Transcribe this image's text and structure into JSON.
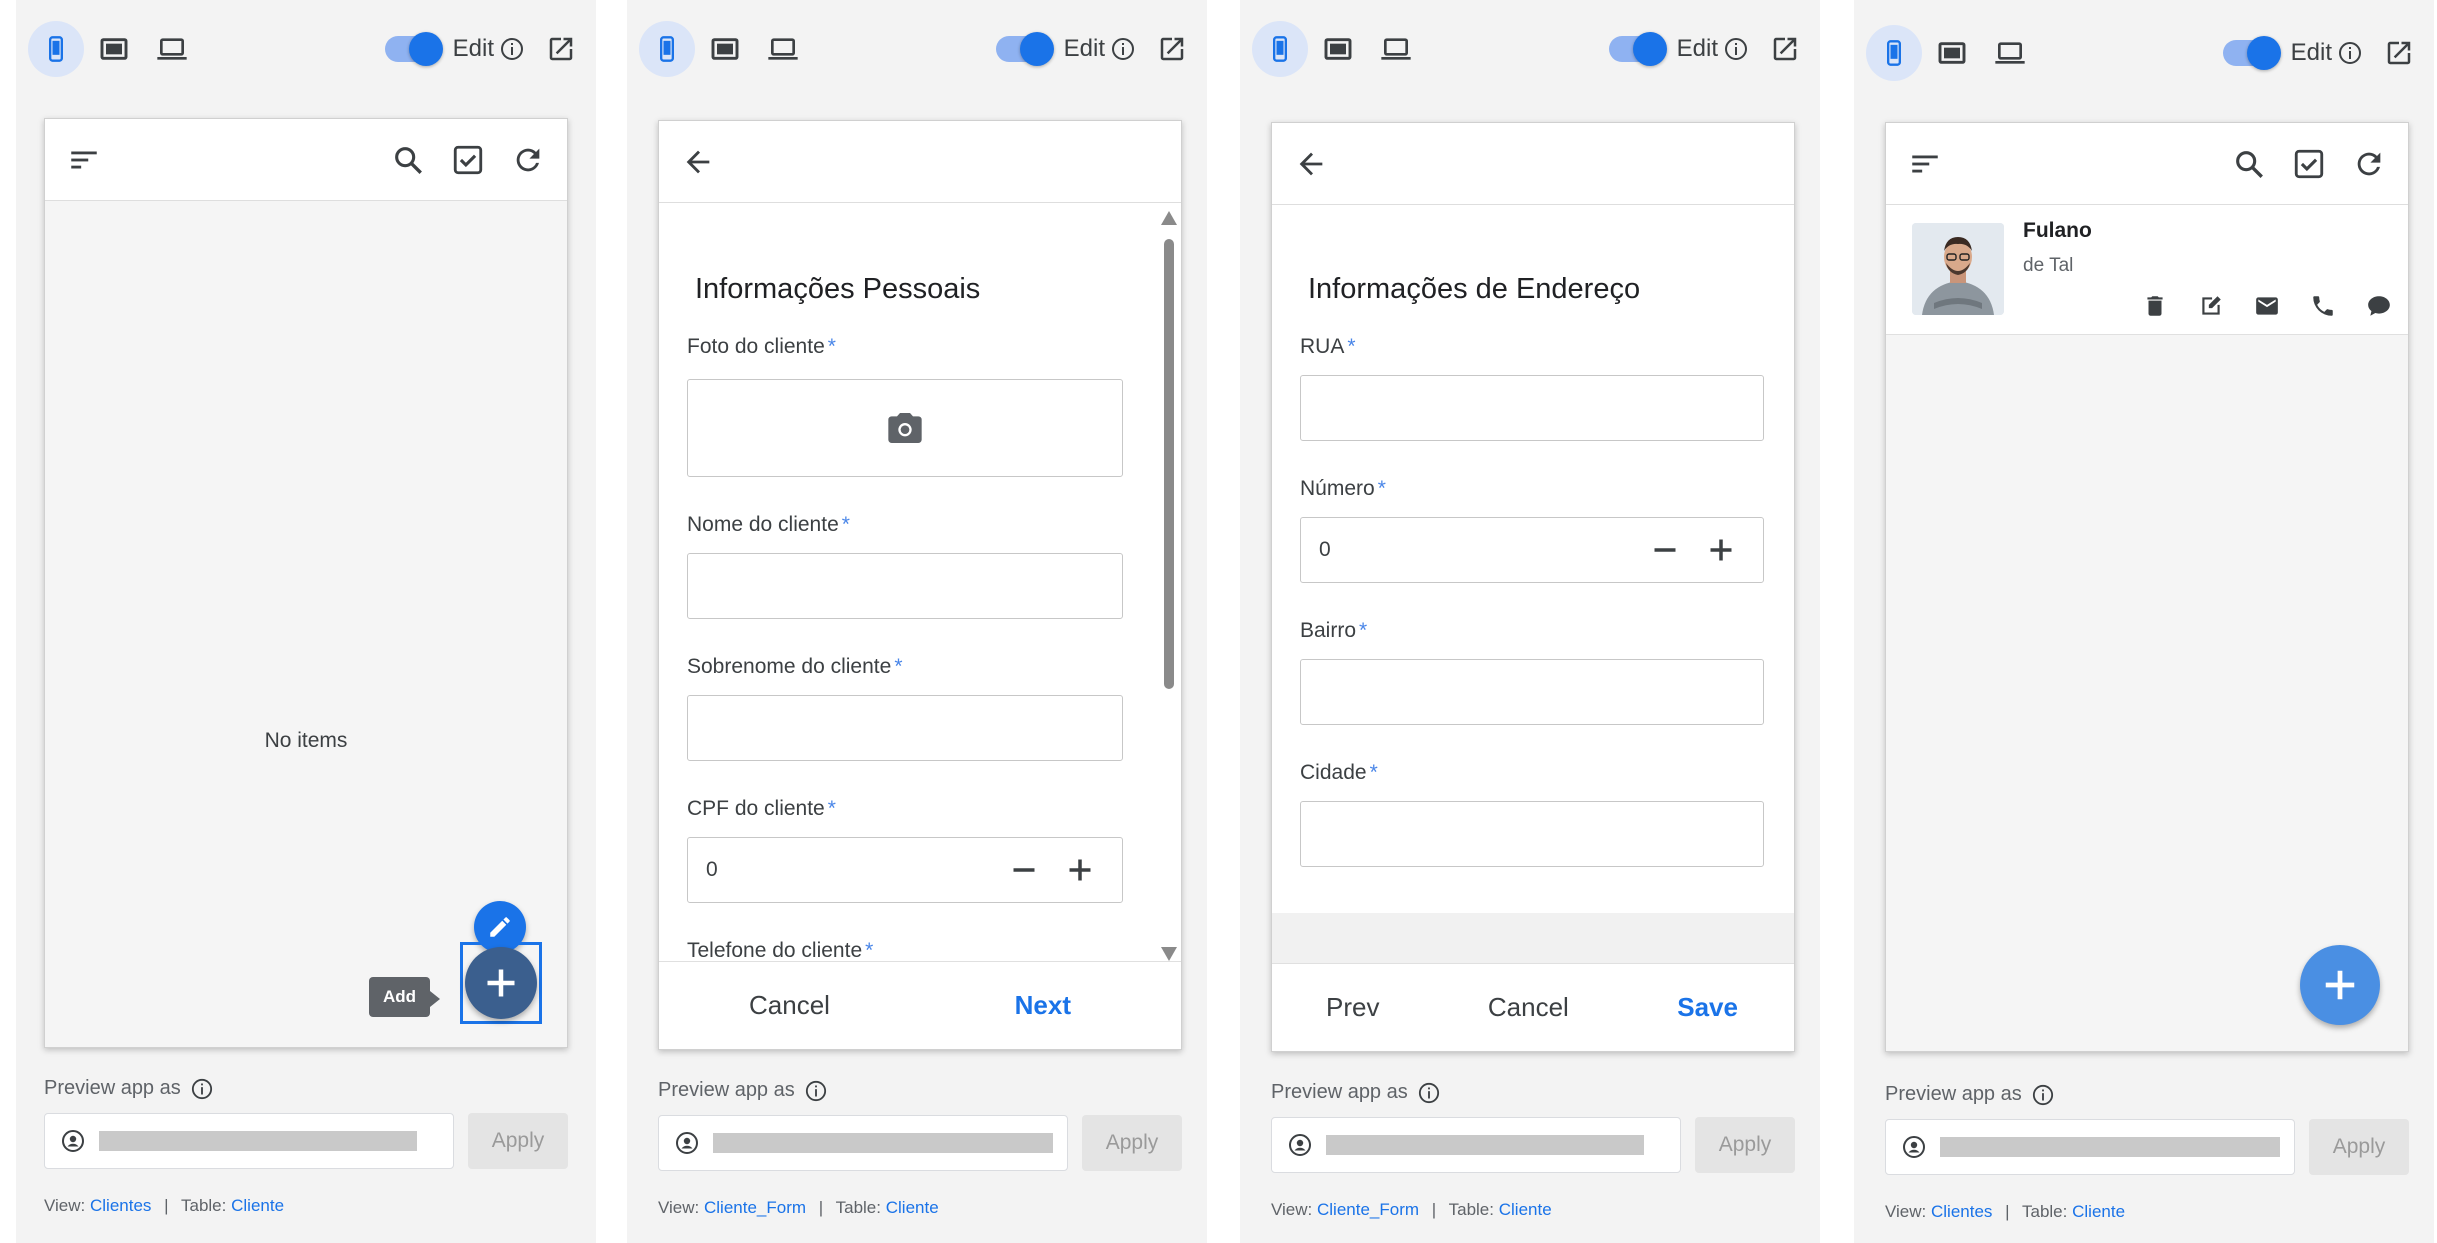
{
  "topbar": {
    "edit_label": "Edit"
  },
  "common": {
    "preview_label": "Preview app as",
    "apply_label": "Apply",
    "view_prefix": "View:",
    "table_prefix": "Table:",
    "separator": "|"
  },
  "panel1": {
    "empty_text": "No items",
    "add_tooltip": "Add",
    "view_name": "Clientes",
    "table_name": "Cliente"
  },
  "panel2": {
    "section_title": "Informações Pessoais",
    "fields": {
      "photo_label": "Foto do cliente",
      "first_name_label": "Nome do cliente",
      "last_name_label": "Sobrenome do cliente",
      "cpf_label": "CPF do cliente",
      "cpf_value": "0",
      "phone_label": "Telefone do cliente"
    },
    "required_mark": "*",
    "cancel_label": "Cancel",
    "next_label": "Next",
    "view_name": "Cliente_Form",
    "table_name": "Cliente"
  },
  "panel3": {
    "section_title": "Informações de Endereço",
    "fields": {
      "street_label": "RUA",
      "number_label": "Número",
      "number_value": "0",
      "district_label": "Bairro",
      "city_label": "Cidade"
    },
    "required_mark": "*",
    "prev_label": "Prev",
    "cancel_label": "Cancel",
    "save_label": "Save",
    "view_name": "Cliente_Form",
    "table_name": "Cliente"
  },
  "panel4": {
    "row_title": "Fulano",
    "row_subtitle": "de Tal",
    "view_name": "Clientes",
    "table_name": "Cliente"
  },
  "colors": {
    "accent": "#1a73e8",
    "fab": "#4a8fe3",
    "required": "#4a86e8"
  },
  "icons": [
    "phone-icon",
    "tablet-icon",
    "laptop-icon",
    "info-icon",
    "open-external-icon",
    "sort-icon",
    "search-icon",
    "checkbox-icon",
    "refresh-icon",
    "back-arrow-icon",
    "camera-icon",
    "minus-icon",
    "plus-icon",
    "pencil-icon",
    "delete-icon",
    "edit-icon",
    "email-icon",
    "call-icon",
    "message-icon",
    "account-circle-icon"
  ]
}
